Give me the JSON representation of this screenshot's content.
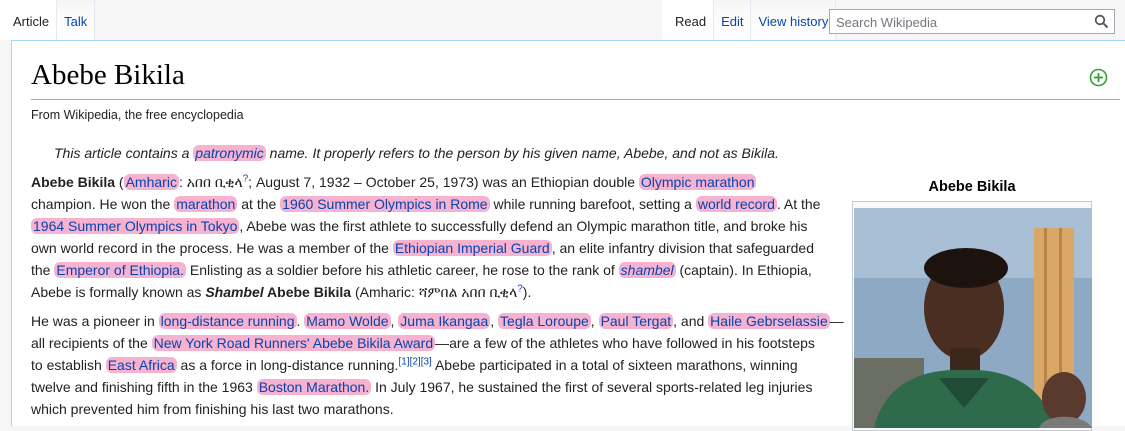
{
  "tabs": {
    "article": "Article",
    "talk": "Talk",
    "read": "Read",
    "edit": "Edit",
    "view_history": "View history"
  },
  "search": {
    "placeholder": "Search Wikipedia"
  },
  "page": {
    "title": "Abebe Bikila",
    "tagline": "From Wikipedia, the free encyclopedia",
    "hatnote": {
      "before": "This article contains a ",
      "link": "patronymic",
      "after": " name. It properly refers to the person by his given name, Abebe, and not as Bikila."
    }
  },
  "p1": {
    "l1_a": "Abebe Bikila",
    "l1_b": " (",
    "l1_amharic": "Amharic",
    "l1_c": ": አበበ ቢቂላ",
    "l1_q": "?",
    "l1_d": "; August 7, 1932 – October 25, 1973) was an Ethiopian double ",
    "l1_link": "Olympic marathon",
    "l2_a": "champion. He won the ",
    "l2_marathon": "marathon",
    "l2_b": " at the ",
    "l2_rome": "1960 Summer Olympics in Rome",
    "l2_c": " while running barefoot, setting a ",
    "l2_record": "world record",
    "l2_d": ". At the",
    "l3_tokyo": "1964 Summer Olympics in Tokyo",
    "l3_a": ", Abebe was the first athlete to successfully defend an Olympic marathon title, and broke his",
    "l4_a": "own world record in the process. He was a member of the ",
    "l4_guard": "Ethiopian Imperial Guard",
    "l4_b": ", an elite infantry division that safeguarded",
    "l5_a": "the ",
    "l5_emperor": "Emperor of Ethiopia.",
    "l5_b": " Enlisting as a soldier before his athletic career, he rose to the rank of ",
    "l5_shambel": "shambel",
    "l5_c": " (captain). In Ethiopia,",
    "l6_a": "Abebe is formally known as ",
    "l6_shambel": "Shambel",
    "l6_b": " Abebe Bikila",
    "l6_c": " (Amharic: ሻምበል አበበ ቢቂላ",
    "l6_q": "?",
    "l6_d": ")."
  },
  "p2": {
    "l1_a": "He was a pioneer in ",
    "l1_ld": "long-distance running",
    "l1_b": ". ",
    "l1_wolde": "Mamo Wolde",
    "l1_c": ", ",
    "l1_ikangaa": "Juma Ikangaa",
    "l1_d": ", ",
    "l1_loroupe": "Tegla Loroupe",
    "l1_e": ", ",
    "l1_tergat": "Paul Tergat",
    "l1_f": ", and ",
    "l1_haile": "Haile Gebrselassie",
    "l1_g": "—",
    "l2_a": "all recipients of the ",
    "l2_award": "New York Road Runners' Abebe Bikila Award",
    "l2_b": "—are a few of the athletes who have followed in his footsteps",
    "l3_a": "to establish ",
    "l3_ea": "East Africa",
    "l3_b": " as a force in long-distance running.",
    "l3_ref1": "[1]",
    "l3_ref2": "[2]",
    "l3_ref3": "[3]",
    "l3_c": " Abebe participated in a total of sixteen marathons, winning",
    "l4_a": "twelve and finishing fifth in the 1963 ",
    "l4_boston": "Boston Marathon.",
    "l4_b": " In July 1967, he sustained the first of several sports-related leg injuries",
    "l5_a": "which prevented him from finishing his last two marathons."
  },
  "infobox": {
    "title": "Abebe Bikila"
  },
  "colors": {
    "link": "#0645ad",
    "highlight": "#f7b2d0",
    "border": "#a7d7f9",
    "watch": "#36a02e"
  },
  "icons": {
    "search": "search-icon",
    "watch": "add-circle-icon"
  }
}
